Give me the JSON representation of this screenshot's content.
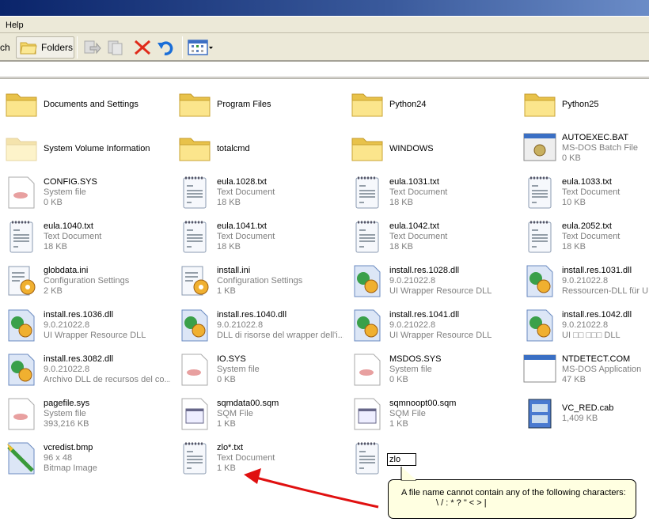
{
  "menu": {
    "help": "Help"
  },
  "toolbar": {
    "search_partial": "ch",
    "folders": "Folders",
    "icons": [
      "move-to-icon",
      "copy-to-icon",
      "delete-icon",
      "undo-icon",
      "views-icon"
    ]
  },
  "items": [
    {
      "name": "Documents and Settings",
      "icon": "folder"
    },
    {
      "name": "Program Files",
      "icon": "folder"
    },
    {
      "name": "Python24",
      "icon": "folder"
    },
    {
      "name": "Python25",
      "icon": "folder"
    },
    {
      "name": "System Volume Information",
      "icon": "folder-hidden"
    },
    {
      "name": "totalcmd",
      "icon": "folder"
    },
    {
      "name": "WINDOWS",
      "icon": "folder"
    },
    {
      "name": "AUTOEXEC.BAT",
      "type": "MS-DOS Batch File",
      "size": "0 KB",
      "icon": "batch"
    },
    {
      "name": "CONFIG.SYS",
      "type": "System file",
      "size": "0 KB",
      "icon": "sys"
    },
    {
      "name": "eula.1028.txt",
      "type": "Text Document",
      "size": "18 KB",
      "icon": "txt"
    },
    {
      "name": "eula.1031.txt",
      "type": "Text Document",
      "size": "18 KB",
      "icon": "txt"
    },
    {
      "name": "eula.1033.txt",
      "type": "Text Document",
      "size": "10 KB",
      "icon": "txt"
    },
    {
      "name": "eula.1040.txt",
      "type": "Text Document",
      "size": "18 KB",
      "icon": "txt"
    },
    {
      "name": "eula.1041.txt",
      "type": "Text Document",
      "size": "18 KB",
      "icon": "txt"
    },
    {
      "name": "eula.1042.txt",
      "type": "Text Document",
      "size": "18 KB",
      "icon": "txt"
    },
    {
      "name": "eula.2052.txt",
      "type": "Text Document",
      "size": "18 KB",
      "icon": "txt"
    },
    {
      "name": "globdata.ini",
      "type": "Configuration Settings",
      "size": "2 KB",
      "icon": "ini"
    },
    {
      "name": "install.ini",
      "type": "Configuration Settings",
      "size": "1 KB",
      "icon": "ini"
    },
    {
      "name": "install.res.1028.dll",
      "type": "9.0.21022.8",
      "size": "UI Wrapper Resource DLL",
      "icon": "dll"
    },
    {
      "name": "install.res.1031.dll",
      "type": "9.0.21022.8",
      "size": "Ressourcen-DLL für UI-",
      "icon": "dll"
    },
    {
      "name": "install.res.1036.dll",
      "type": "9.0.21022.8",
      "size": "UI Wrapper Resource DLL",
      "icon": "dll"
    },
    {
      "name": "install.res.1040.dll",
      "type": "9.0.21022.8",
      "size": "DLL di risorse del wrapper dell'i...",
      "icon": "dll"
    },
    {
      "name": "install.res.1041.dll",
      "type": "9.0.21022.8",
      "size": "UI Wrapper Resource DLL",
      "icon": "dll"
    },
    {
      "name": "install.res.1042.dll",
      "type": "9.0.21022.8",
      "size": "UI □□ □□□ DLL",
      "icon": "dll"
    },
    {
      "name": "install.res.3082.dll",
      "type": "9.0.21022.8",
      "size": "Archivo DLL de recursos del co...",
      "icon": "dll"
    },
    {
      "name": "IO.SYS",
      "type": "System file",
      "size": "0 KB",
      "icon": "sys"
    },
    {
      "name": "MSDOS.SYS",
      "type": "System file",
      "size": "0 KB",
      "icon": "sys"
    },
    {
      "name": "NTDETECT.COM",
      "type": "MS-DOS Application",
      "size": "47 KB",
      "icon": "app"
    },
    {
      "name": "pagefile.sys",
      "type": "System file",
      "size": "393,216 KB",
      "icon": "sys"
    },
    {
      "name": "sqmdata00.sqm",
      "type": "SQM File",
      "size": "1 KB",
      "icon": "sqm"
    },
    {
      "name": "sqmnoopt00.sqm",
      "type": "SQM File",
      "size": "1 KB",
      "icon": "sqm"
    },
    {
      "name": "VC_RED.cab",
      "type": "1,409 KB",
      "icon": "cab"
    },
    {
      "name": "vcredist.bmp",
      "type": "96 x 48",
      "size": "Bitmap Image",
      "icon": "bmp"
    },
    {
      "name": "zlo*.txt",
      "type": "Text Document",
      "size": "1 KB",
      "icon": "txt"
    },
    {
      "name": "",
      "icon": "txt",
      "renaming": true
    }
  ],
  "rename": {
    "value": "zlo"
  },
  "tooltip": {
    "line1": "A file name cannot contain any of the following characters:",
    "line2": "\\ / : * ? \" < > |"
  },
  "colors": {
    "annotation_arrow": "#e01010",
    "tooltip_bg": "#ffffe1"
  }
}
